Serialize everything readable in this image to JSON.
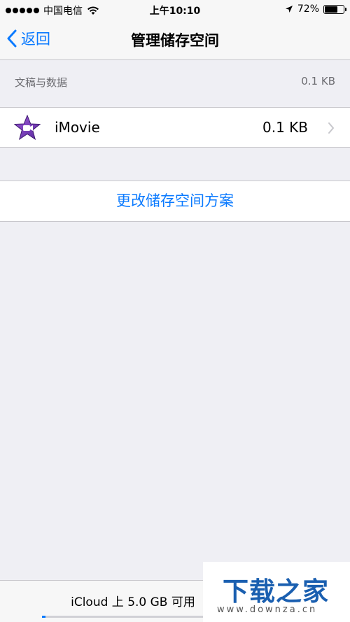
{
  "status_bar": {
    "carrier": "中国电信",
    "time": "上午10:10",
    "battery_percent": "72%",
    "battery_level": 0.72,
    "signal_icon": "signal-dots-icon",
    "wifi_icon": "wifi-icon",
    "location_icon": "location-arrow-icon"
  },
  "nav": {
    "back_label": "返回",
    "title": "管理储存空间"
  },
  "section": {
    "header_label": "文稿与数据",
    "header_size": "0.1 KB"
  },
  "apps": [
    {
      "name": "iMovie",
      "size": "0.1 KB",
      "icon": "imovie-star-icon"
    }
  ],
  "actions": {
    "change_plan": "更改储存空间方案"
  },
  "bottom": {
    "storage_text": "iCloud 上 5.0 GB 可用",
    "progress": 0.02
  },
  "watermark": {
    "main": "下载之家",
    "url": "www.downza.cn"
  },
  "colors": {
    "accent": "#0a7aff",
    "background": "#efeff4"
  }
}
